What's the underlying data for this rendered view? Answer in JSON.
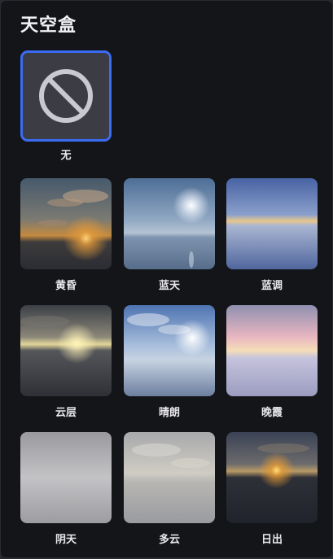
{
  "panel": {
    "title": "天空盒"
  },
  "none_option": {
    "label": "无",
    "selected": true,
    "icon": "prohibited-icon",
    "accent_color": "#3a6cf3"
  },
  "skyboxes": [
    {
      "id": "dusk",
      "label": "黄昏"
    },
    {
      "id": "blue-sky",
      "label": "蓝天"
    },
    {
      "id": "blue-hour",
      "label": "蓝调"
    },
    {
      "id": "cloud-layer",
      "label": "云层"
    },
    {
      "id": "clear",
      "label": "晴朗"
    },
    {
      "id": "sunset-glow",
      "label": "晚霞"
    },
    {
      "id": "overcast",
      "label": "阴天"
    },
    {
      "id": "cloudy",
      "label": "多云"
    },
    {
      "id": "sunrise",
      "label": "日出"
    }
  ]
}
